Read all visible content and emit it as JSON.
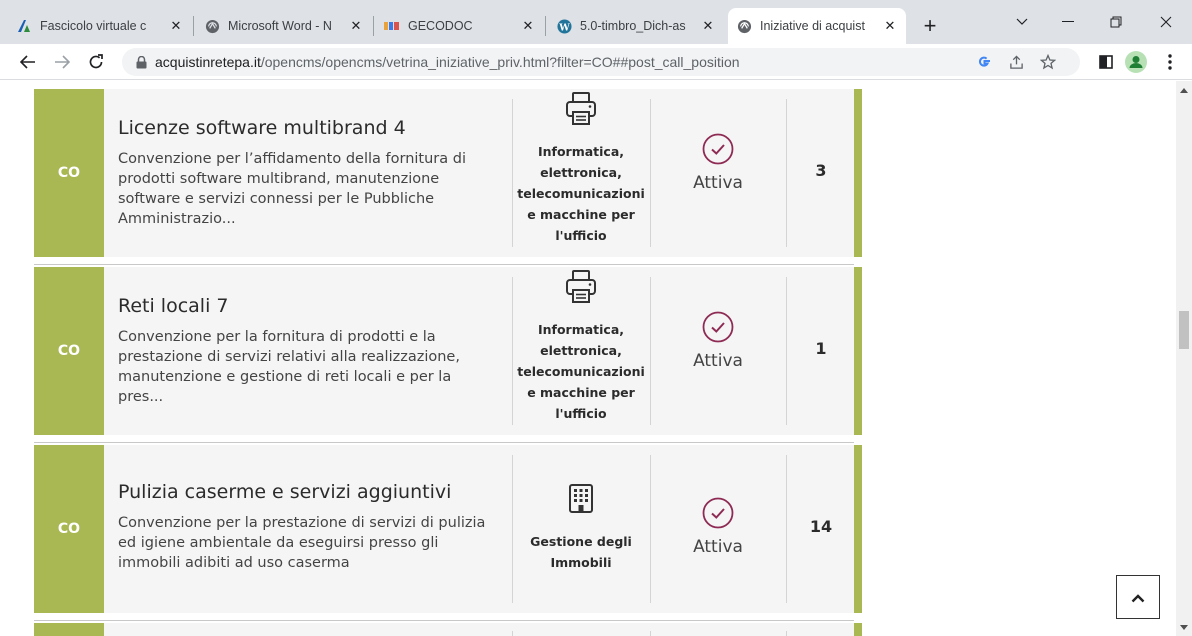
{
  "browser": {
    "tabs": [
      {
        "title": "Fascicolo virtuale c",
        "icon": "app-a-icon",
        "active": false
      },
      {
        "title": "Microsoft Word - N",
        "icon": "globe-icon",
        "active": false
      },
      {
        "title": "GECODOC",
        "icon": "gecodoc-icon",
        "active": false
      },
      {
        "title": "5.0-timbro_Dich-as",
        "icon": "wordpress-icon",
        "active": false
      },
      {
        "title": "Iniziative di acquist",
        "icon": "globe-icon",
        "active": true
      }
    ],
    "close_glyph": "✕",
    "new_tab_glyph": "+",
    "url_host": "acquistinretepa.it",
    "url_path": "/opencms/opencms/vetrina_iniziative_priv.html?filter=CO##post_call_position"
  },
  "initiatives": [
    {
      "badge": "CO",
      "title": "Licenze software multibrand 4",
      "description": "Convenzione per l’affidamento della fornitura di prodotti software multibrand, manutenzione software e servizi connessi per le Pubbliche Amministrazio...",
      "category_icon": "printer-icon",
      "category_lines": [
        "Informatica,",
        "elettronica,",
        "telecomunicazioni",
        "e macchine per",
        "l'ufficio"
      ],
      "status": "Attiva",
      "count": "3"
    },
    {
      "badge": "CO",
      "title": "Reti locali 7",
      "description": "Convenzione per la fornitura di prodotti e la prestazione di servizi relativi alla realizzazione, manutenzione e gestione di reti locali e per la pres...",
      "category_icon": "printer-icon",
      "category_lines": [
        "Informatica,",
        "elettronica,",
        "telecomunicazioni",
        "e macchine per",
        "l'ufficio"
      ],
      "status": "Attiva",
      "count": "1"
    },
    {
      "badge": "CO",
      "title": "Pulizia caserme e servizi aggiuntivi",
      "description": "Convenzione per la prestazione di servizi di pulizia ed igiene ambientale da eseguirsi presso gli immobili adibiti ad uso caserma",
      "category_icon": "building-icon",
      "category_lines": [
        "Gestione degli",
        "Immobili"
      ],
      "status": "Attiva",
      "count": "14"
    }
  ],
  "colors": {
    "accent_green": "#a9b853",
    "status_purple": "#8e2b54",
    "card_bg": "#f5f5f5"
  }
}
